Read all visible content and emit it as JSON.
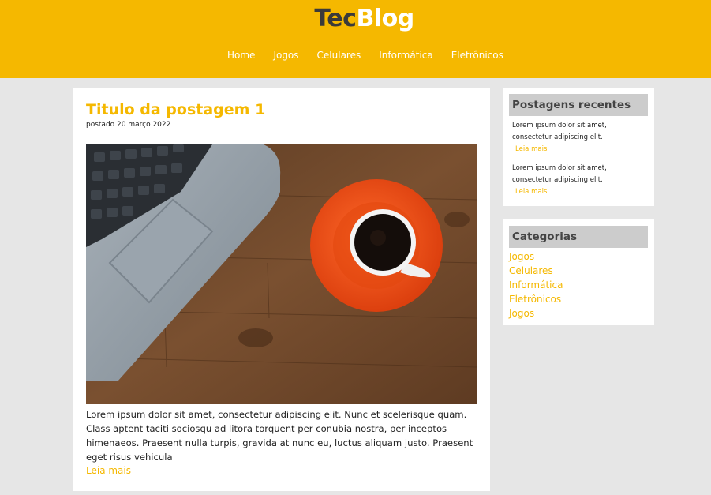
{
  "site": {
    "logo_part1": "Tec",
    "logo_part2": "Blog",
    "brand_color": "#f5b800"
  },
  "nav": {
    "items": [
      {
        "label": "Home"
      },
      {
        "label": "Jogos"
      },
      {
        "label": "Celulares"
      },
      {
        "label": "Informática"
      },
      {
        "label": "Eletrônicos"
      }
    ]
  },
  "post": {
    "title": "Titulo da postagem 1",
    "date": "postado 20 março 2022",
    "image_icon": "laptop-coffee-photo",
    "body": "Lorem ipsum dolor sit amet, consectetur adipiscing elit. Nunc et scelerisque quam. Class aptent taciti sociosqu ad litora torquent per conubia nostra, per inceptos himenaeos. Praesent nulla turpis, gravida at nunc eu, luctus aliquam justo. Praesent eget risus vehicula",
    "read_more": "Leia mais"
  },
  "sidebar": {
    "recent": {
      "title": "Postagens recentes",
      "items": [
        {
          "text": "Lorem ipsum dolor sit amet, consectetur adipiscing elit.",
          "more": "Leia mais"
        },
        {
          "text": "Lorem ipsum dolor sit amet, consectetur adipiscing elit.",
          "more": "Leia mais"
        }
      ]
    },
    "categories": {
      "title": "Categorias",
      "items": [
        "Jogos",
        "Celulares",
        "Informática",
        "Eletrônicos",
        "Jogos"
      ]
    }
  }
}
